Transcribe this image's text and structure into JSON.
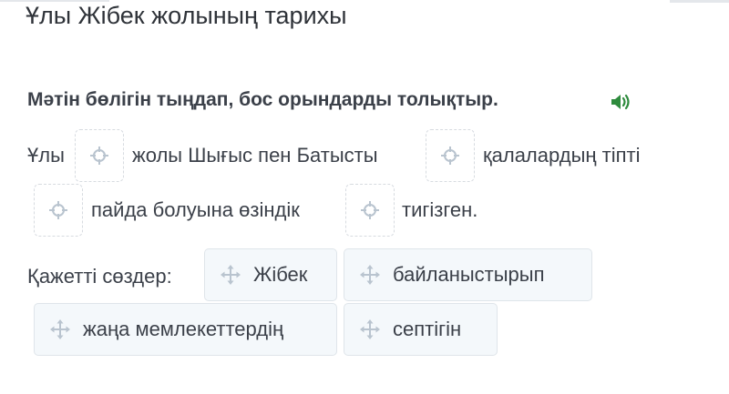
{
  "title": "Ұлы Жібек жолының тарихы",
  "instruction": "Мәтін бөлігін тыңдап, бос орындарды толықтыр.",
  "sentence": {
    "w1": "Ұлы",
    "w2": "жолы Шығыс пен Батысты",
    "w3": "қалалардың тіпті",
    "w4": "пайда болуына өзіндік",
    "w5": "тигізген."
  },
  "words_label": "Қажетті сөздер:",
  "words": [
    "Жібек",
    "байланыстырып",
    "жаңа мемлекеттердің",
    "септігін"
  ],
  "icons": {
    "speaker": "speaker-icon",
    "blank": "target-crosshair-icon",
    "chip": "move-arrows-icon"
  },
  "colors": {
    "speaker": "#2e8b3d",
    "text": "#3b4049",
    "chip_bg": "#f4f8fb",
    "icon": "#b9c4cf"
  }
}
